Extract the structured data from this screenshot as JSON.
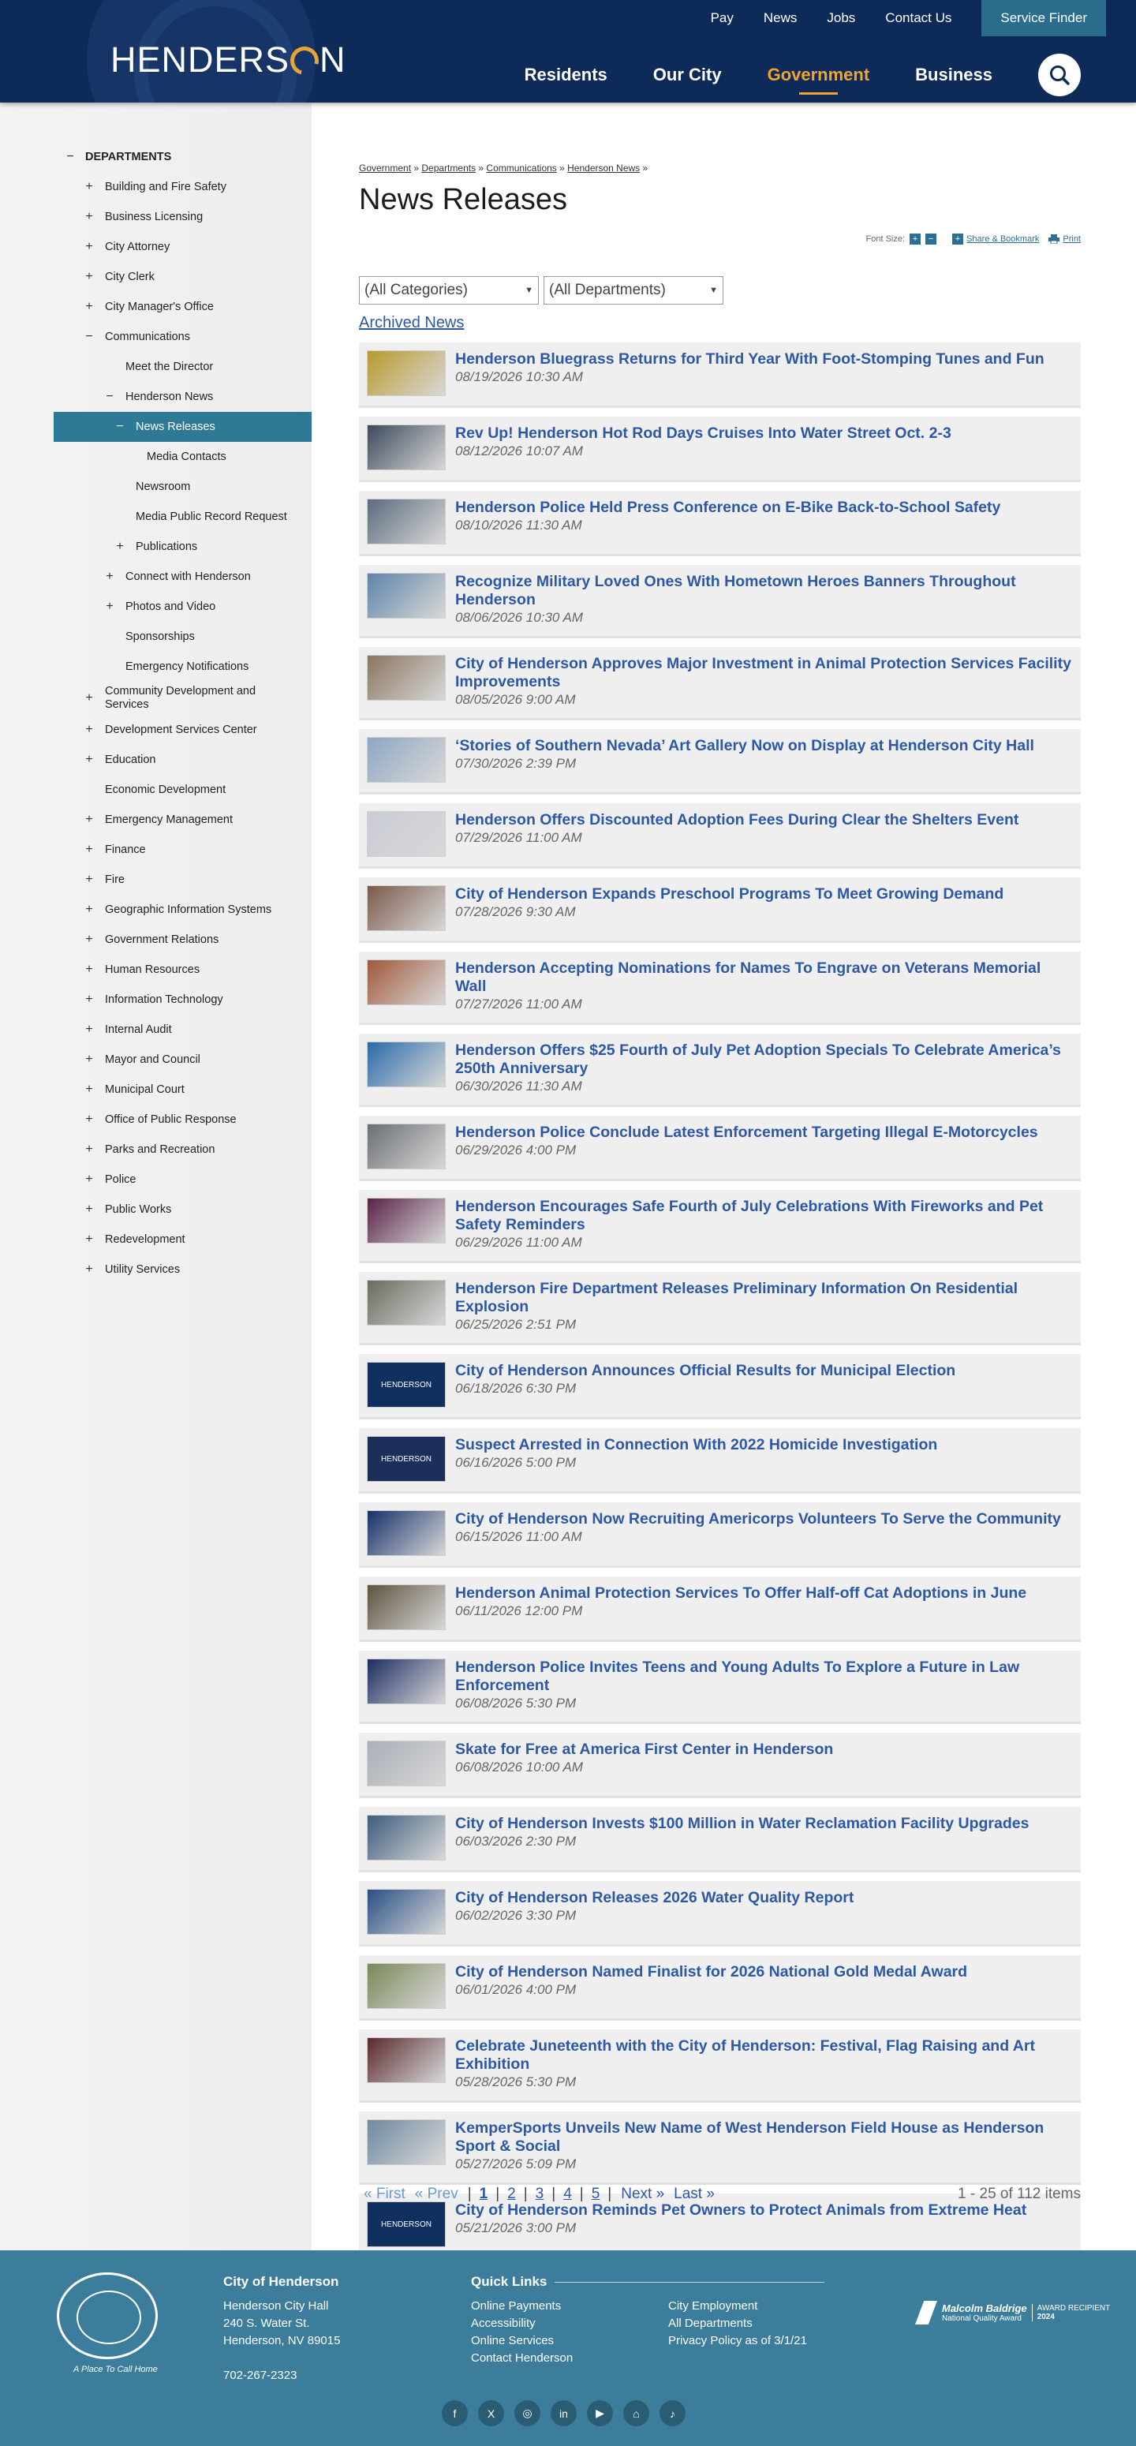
{
  "header": {
    "logo_text": "HENDERSON",
    "utility_links": [
      "Pay",
      "News",
      "Jobs",
      "Contact Us"
    ],
    "service_finder": "Service Finder",
    "main_nav": [
      "Residents",
      "Our City",
      "Government",
      "Business"
    ],
    "active_nav": "Government",
    "accent_color": "#f0a530",
    "header_bg": "#0d2a58",
    "search_icon": "search-icon"
  },
  "sidebar": {
    "root": {
      "label": "DEPARTMENTS",
      "toggle": "−"
    },
    "items": [
      {
        "label": "Building and Fire Safety",
        "toggle": "+",
        "level": 1
      },
      {
        "label": "Business Licensing",
        "toggle": "+",
        "level": 1
      },
      {
        "label": "City Attorney",
        "toggle": "+",
        "level": 1
      },
      {
        "label": "City Clerk",
        "toggle": "+",
        "level": 1
      },
      {
        "label": "City Manager's Office",
        "toggle": "+",
        "level": 1
      },
      {
        "label": "Communications",
        "toggle": "−",
        "level": 1
      },
      {
        "label": "Meet the Director",
        "toggle": "",
        "level": 2
      },
      {
        "label": "Henderson News",
        "toggle": "−",
        "level": 2
      },
      {
        "label": "News Releases",
        "toggle": "−",
        "level": 3,
        "selected": true
      },
      {
        "label": "Media Contacts",
        "toggle": "",
        "level": 4
      },
      {
        "label": "Newsroom",
        "toggle": "",
        "level": 3
      },
      {
        "label": "Media Public Record Request",
        "toggle": "",
        "level": 3
      },
      {
        "label": "Publications",
        "toggle": "+",
        "level": 3
      },
      {
        "label": "Connect with Henderson",
        "toggle": "+",
        "level": 2
      },
      {
        "label": "Photos and Video",
        "toggle": "+",
        "level": 2
      },
      {
        "label": "Sponsorships",
        "toggle": "",
        "level": 2
      },
      {
        "label": "Emergency Notifications",
        "toggle": "",
        "level": 2
      },
      {
        "label": "Community Development and Services",
        "toggle": "+",
        "level": 1
      },
      {
        "label": "Development Services Center",
        "toggle": "+",
        "level": 1
      },
      {
        "label": "Education",
        "toggle": "+",
        "level": 1
      },
      {
        "label": "Economic Development",
        "toggle": "",
        "level": 1
      },
      {
        "label": "Emergency Management",
        "toggle": "+",
        "level": 1
      },
      {
        "label": "Finance",
        "toggle": "+",
        "level": 1
      },
      {
        "label": "Fire",
        "toggle": "+",
        "level": 1
      },
      {
        "label": "Geographic Information Systems",
        "toggle": "+",
        "level": 1
      },
      {
        "label": "Government Relations",
        "toggle": "+",
        "level": 1
      },
      {
        "label": "Human Resources",
        "toggle": "+",
        "level": 1
      },
      {
        "label": "Information Technology",
        "toggle": "+",
        "level": 1
      },
      {
        "label": "Internal Audit",
        "toggle": "+",
        "level": 1
      },
      {
        "label": "Mayor and Council",
        "toggle": "+",
        "level": 1
      },
      {
        "label": "Municipal Court",
        "toggle": "+",
        "level": 1
      },
      {
        "label": "Office of Public Response",
        "toggle": "+",
        "level": 1
      },
      {
        "label": "Parks and Recreation",
        "toggle": "+",
        "level": 1
      },
      {
        "label": "Police",
        "toggle": "+",
        "level": 1
      },
      {
        "label": "Public Works",
        "toggle": "+",
        "level": 1
      },
      {
        "label": "Redevelopment",
        "toggle": "+",
        "level": 1
      },
      {
        "label": "Utility Services",
        "toggle": "+",
        "level": 1
      }
    ]
  },
  "breadcrumb": [
    "Government",
    "Departments",
    "Communications",
    "Henderson News"
  ],
  "page_title": "News Releases",
  "tools": {
    "font_size_label": "Font Size:",
    "plus": "+",
    "minus": "−",
    "share": "Share & Bookmark",
    "print": "Print"
  },
  "filters": {
    "category": "(All Categories)",
    "department": "(All Departments)"
  },
  "archived_link": "Archived News",
  "news": [
    {
      "title": "Henderson Bluegrass Returns for Third Year With Foot-Stomping Tunes and Fun",
      "date": "08/19/2026 10:30 AM",
      "thumb": "#b99a2e"
    },
    {
      "title": "Rev Up! Henderson Hot Rod Days Cruises Into Water Street Oct. 2-3",
      "date": "08/12/2026 10:07 AM",
      "thumb": "#3d4a5c"
    },
    {
      "title": "Henderson Police Held Press Conference on E-Bike Back-to-School Safety",
      "date": "08/10/2026 11:30 AM",
      "thumb": "#5c6b7e"
    },
    {
      "title": "Recognize Military Loved Ones With Hometown Heroes Banners Throughout Henderson",
      "date": "08/06/2026 10:30 AM",
      "thumb": "#5f84a8"
    },
    {
      "title": "City of Henderson Approves Major Investment in Animal Protection Services Facility Improvements",
      "date": "08/05/2026 9:00 AM",
      "thumb": "#8a7560"
    },
    {
      "title": "‘Stories of Southern Nevada’ Art Gallery Now on Display at Henderson City Hall",
      "date": "07/30/2026 2:39 PM",
      "thumb": "#8ea6c2"
    },
    {
      "title": "Henderson Offers Discounted Adoption Fees During Clear the Shelters Event",
      "date": "07/29/2026 11:00 AM",
      "thumb": "#c9ccd6"
    },
    {
      "title": "City of Henderson Expands Preschool Programs To Meet Growing Demand",
      "date": "07/28/2026 9:30 AM",
      "thumb": "#7a5a4a"
    },
    {
      "title": "Henderson Accepting Nominations for Names To Engrave on Veterans Memorial Wall",
      "date": "07/27/2026 11:00 AM",
      "thumb": "#a0583a"
    },
    {
      "title": "Henderson Offers $25 Fourth of July Pet Adoption Specials To Celebrate America’s 250th Anniversary",
      "date": "06/30/2026 11:30 AM",
      "thumb": "#2a6aa8"
    },
    {
      "title": "Henderson Police Conclude Latest Enforcement Targeting Illegal E-Motorcycles",
      "date": "06/29/2026 4:00 PM",
      "thumb": "#6a6f73"
    },
    {
      "title": "Henderson Encourages Safe Fourth of July Celebrations With Fireworks and Pet Safety Reminders",
      "date": "06/29/2026 11:00 AM",
      "thumb": "#5a2248"
    },
    {
      "title": "Henderson Fire Department Releases Preliminary Information On Residential Explosion",
      "date": "06/25/2026 2:51 PM",
      "thumb": "#6b6a5e"
    },
    {
      "title": "City of Henderson Announces Official Results for Municipal Election",
      "date": "06/18/2026 6:30 PM",
      "thumb": "#0f2f5f",
      "logo": "HENDERSON"
    },
    {
      "title": "Suspect Arrested in Connection With 2022 Homicide Investigation",
      "date": "06/16/2026 5:00 PM",
      "thumb": "#1c2f5a",
      "logo": "HENDERSON"
    },
    {
      "title": "City of Henderson Now Recruiting Americorps Volunteers To Serve the Community",
      "date": "06/15/2026 11:00 AM",
      "thumb": "#16306a"
    },
    {
      "title": "Henderson Animal Protection Services To Offer Half-off Cat Adoptions in June",
      "date": "06/11/2026 12:00 PM",
      "thumb": "#5e5340"
    },
    {
      "title": "Henderson Police Invites Teens and Young Adults To Explore a Future in Law Enforcement",
      "date": "06/08/2026 5:30 PM",
      "thumb": "#1d2d63"
    },
    {
      "title": "Skate for Free at America First Center in Henderson",
      "date": "06/08/2026 10:00 AM",
      "thumb": "#a9b0b8"
    },
    {
      "title": "City of Henderson Invests $100 Million in Water Reclamation Facility Upgrades",
      "date": "06/03/2026 2:30 PM",
      "thumb": "#3d5c7e"
    },
    {
      "title": "City of Henderson Releases 2026 Water Quality Report",
      "date": "06/02/2026 3:30 PM",
      "thumb": "#2a4f86"
    },
    {
      "title": "City of Henderson Named Finalist for 2026 National Gold Medal Award",
      "date": "06/01/2026 4:00 PM",
      "thumb": "#7a8a5a"
    },
    {
      "title": "Celebrate Juneteenth with the City of Henderson: Festival, Flag Raising and Art Exhibition",
      "date": "05/28/2026 5:30 PM",
      "thumb": "#5a2a2e"
    },
    {
      "title": "KemperSports Unveils New Name of West Henderson Field House as Henderson Sport & Social",
      "date": "05/27/2026 5:09 PM",
      "thumb": "#6f8aa0"
    },
    {
      "title": "City of Henderson Reminds Pet Owners to Protect Animals from Extreme Heat",
      "date": "05/21/2026 3:00 PM",
      "thumb": "#0f2f5f",
      "logo": "HENDERSON"
    }
  ],
  "pager": {
    "first": "« First",
    "prev": "« Prev",
    "pages": [
      "1",
      "2",
      "3",
      "4",
      "5"
    ],
    "current": "1",
    "next": "Next »",
    "last": "Last »",
    "count": "1 - 25 of 112 items"
  },
  "footer": {
    "tagline": "A Place To Call Home",
    "city_heading": "City of Henderson",
    "address": [
      "Henderson City Hall",
      "240 S. Water St.",
      "Henderson, NV 89015"
    ],
    "phone": "702-267-2323",
    "quick_heading": "Quick Links",
    "quick_links_col1": [
      "Online Payments",
      "Accessibility",
      "Online Services",
      "Contact Henderson"
    ],
    "quick_links_col2": [
      "City Employment",
      "All Departments",
      "Privacy Policy as of 3/1/21"
    ],
    "award_name": "Malcolm Baldrige",
    "award_sub": "National Quality Award",
    "award_badge": "AWARD RECIPIENT",
    "award_year": "2024",
    "social": [
      {
        "icon": "facebook-icon",
        "glyph": "f"
      },
      {
        "icon": "x-icon",
        "glyph": "X"
      },
      {
        "icon": "instagram-icon",
        "glyph": "◎"
      },
      {
        "icon": "linkedin-icon",
        "glyph": "in"
      },
      {
        "icon": "youtube-icon",
        "glyph": "▶"
      },
      {
        "icon": "nextdoor-icon",
        "glyph": "⌂"
      },
      {
        "icon": "tiktok-icon",
        "glyph": "♪"
      }
    ]
  }
}
